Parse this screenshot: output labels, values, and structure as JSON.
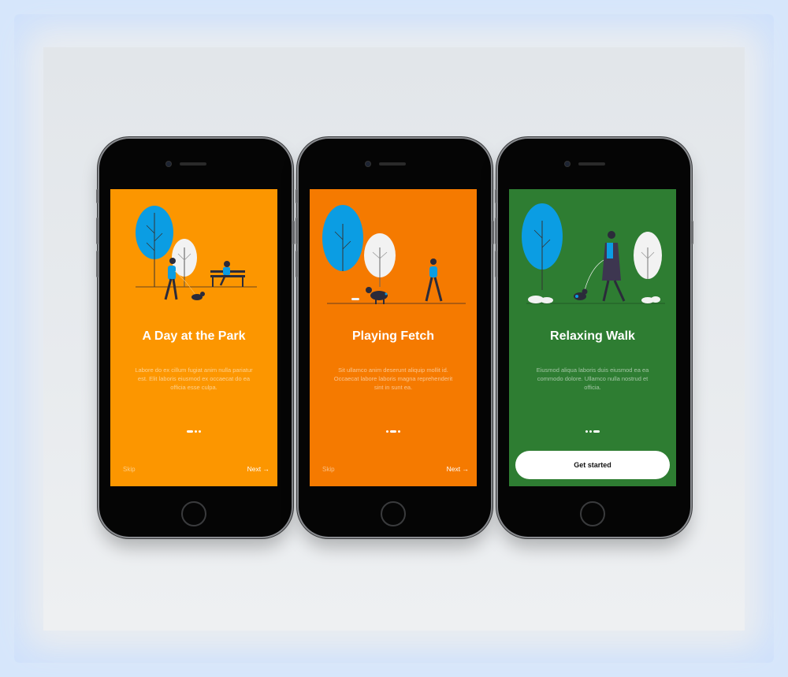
{
  "colors": {
    "screen1_bg": "#fc9600",
    "screen2_bg": "#f57a00",
    "screen3_bg": "#2e7d32",
    "tree_blue": "#0b9de3",
    "tree_white": "#f2f2f2"
  },
  "screens": [
    {
      "title": "A Day at the Park",
      "body": "Labore do ex cillum fugiat anim nulla pariatur est. Elit laboris eiusmod ex occaecat do ea officia esse culpa.",
      "skip_label": "Skip",
      "next_label": "Next →",
      "active_step": 1
    },
    {
      "title": "Playing Fetch",
      "body": "Sit ullamco anim deserunt aliquip mollit id. Occaecat labore laboris magna reprehenderit sint in sunt ea.",
      "skip_label": "Skip",
      "next_label": "Next →",
      "active_step": 2
    },
    {
      "title": "Relaxing Walk",
      "body": "Eiusmod aliqua laboris duis eiusmod ea ea commodo dolore. Ullamco nulla nostrud et officia.",
      "cta_label": "Get started",
      "active_step": 3
    }
  ]
}
